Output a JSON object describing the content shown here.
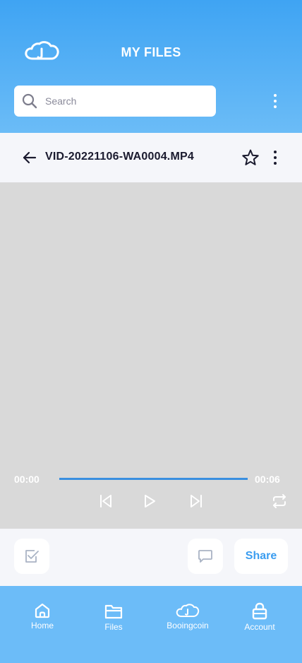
{
  "header": {
    "title": "MY FILES",
    "logo_icon": "cloud-logo-icon"
  },
  "search": {
    "placeholder": "Search"
  },
  "file": {
    "name": "VID-20221106-WA0004.MP4",
    "starred": false
  },
  "player": {
    "current_time": "00:00",
    "duration": "00:06",
    "progress": 1.0
  },
  "actions": {
    "share_label": "Share"
  },
  "nav": {
    "items": [
      {
        "label": "Home",
        "icon": "home-icon"
      },
      {
        "label": "Files",
        "icon": "folder-icon"
      },
      {
        "label": "Booingcoin",
        "icon": "cloud-icon"
      },
      {
        "label": "Account",
        "icon": "lock-icon"
      }
    ]
  },
  "colors": {
    "header_top": "#3fa4f3",
    "header_bottom": "#6bbcf7",
    "accent": "#3b9df0",
    "video_bg": "#d9d9d9",
    "nav_bg": "#6cbcf8"
  }
}
